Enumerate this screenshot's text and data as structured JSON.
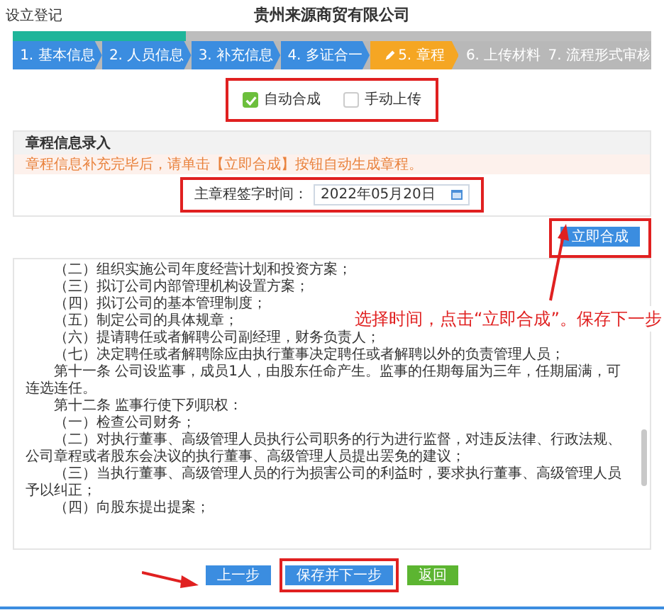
{
  "header": {
    "section": "设立登记",
    "company": "贵州来源商贸有限公司"
  },
  "progress": {
    "level": 0.27
  },
  "steps": [
    {
      "label": "1. 基本信息",
      "completed": true,
      "selected": false
    },
    {
      "label": "2. 人员信息",
      "completed": true,
      "selected": false
    },
    {
      "label": "3. 补充信息",
      "completed": true,
      "selected": false
    },
    {
      "label": "4. 多证合一",
      "completed": true,
      "selected": false
    },
    {
      "label": "5. 章程",
      "completed": false,
      "selected": true
    },
    {
      "label": "6. 上传材料",
      "completed": false,
      "selected": false
    },
    {
      "label": "7. 流程形式审核",
      "completed": false,
      "selected": false
    }
  ],
  "modes": [
    {
      "label": "自动合成",
      "checked": true
    },
    {
      "label": "手动上传",
      "checked": false
    }
  ],
  "panel": {
    "title": "章程信息录入",
    "note": "章程信息补充完毕后，请单击【立即合成】按钮自动生成章程。",
    "date_label": "主章程签字时间：",
    "date_value": "2022年05月20日",
    "generate_button": "立即合成"
  },
  "document": {
    "paragraphs": [
      "（二）组织实施公司年度经营计划和投资方案；",
      "（三）拟订公司内部管理机构设置方案；",
      "（四）拟订公司的基本管理制度；",
      "（五）制定公司的具体规章；",
      "（六）提请聘任或者解聘公司副经理，财务负责人；",
      "（七）决定聘任或者解聘除应由执行董事决定聘任或者解聘以外的负责管理人员；",
      "第十一条  公司设监事，成员1人，由股东任命产生。监事的任期每届为三年，任期届满，可连选连任。",
      "第十二条  监事行使下列职权：",
      "（一）检查公司财务；",
      "（二）对执行董事、高级管理人员执行公司职务的行为进行监督，对违反法律、行政法规、公司章程或者股东会决议的执行董事、高级管理人员提出罢免的建议；",
      "（三）当执行董事、高级管理人员的行为损害公司的利益时，要求执行董事、高级管理人员予以纠正；",
      "（四）向股东提出提案；"
    ]
  },
  "annotation": "选择时间，点击“立即合成”。保存下一步",
  "footer_buttons": [
    {
      "label": "上一步",
      "kind": "prev"
    },
    {
      "label": "保存并下一步",
      "kind": "save"
    },
    {
      "label": "返回",
      "kind": "back"
    }
  ]
}
